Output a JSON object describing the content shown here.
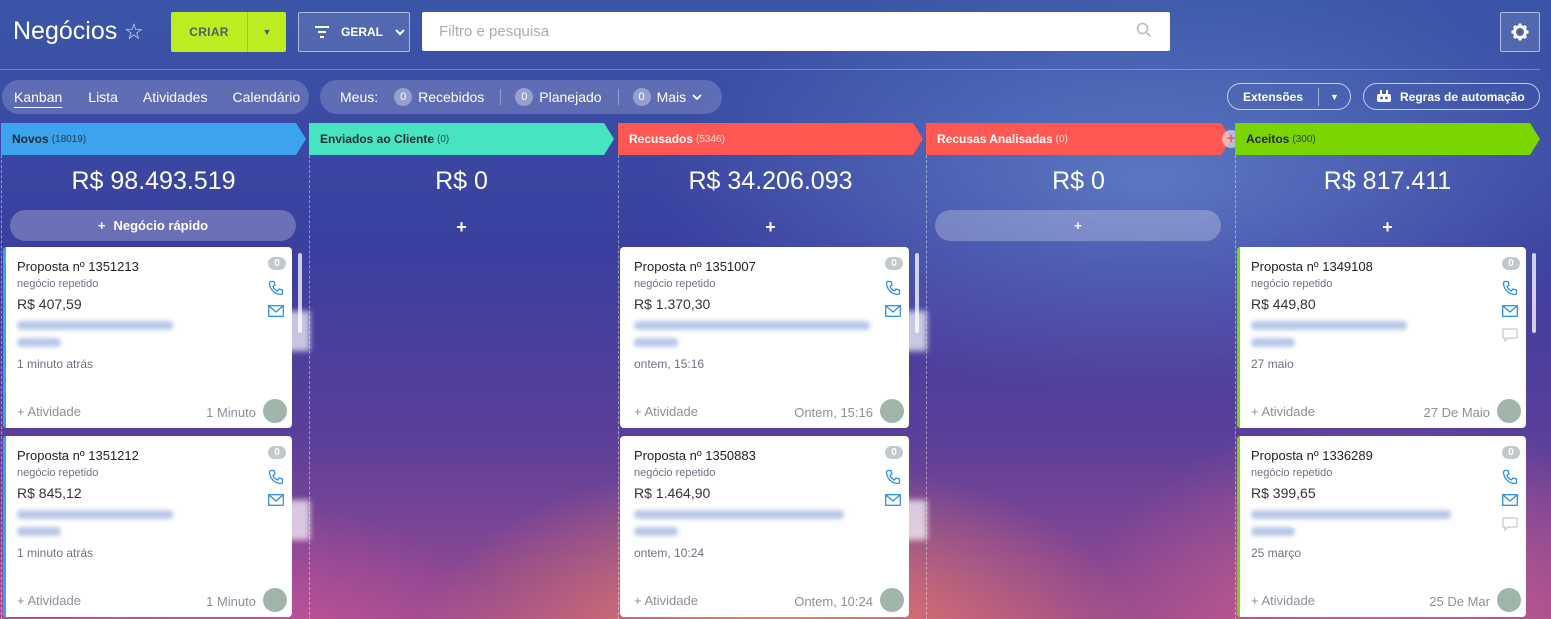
{
  "header": {
    "title": "Negócios",
    "create_label": "CRIAR",
    "filter_label": "GERAL",
    "search_placeholder": "Filtro e pesquisa"
  },
  "views": [
    "Kanban",
    "Lista",
    "Atividades",
    "Calendário"
  ],
  "counters": {
    "label": "Meus:",
    "items": [
      {
        "count": "0",
        "label": "Recebidos"
      },
      {
        "count": "0",
        "label": "Planejado"
      },
      {
        "count": "0",
        "label": "Mais"
      }
    ]
  },
  "toolbar": {
    "extensions_label": "Extensões",
    "automation_label": "Regras de automação"
  },
  "colors": {
    "create_button": "#bbed21",
    "stage_novos": "#3ea3ee",
    "stage_enviados": "#47e4c2",
    "stage_recusados": "#ff5752",
    "stage_analisadas": "#ff5752",
    "stage_aceitos": "#7bd500"
  },
  "columns": [
    {
      "name": "Novos",
      "count": "(18019)",
      "total": "R$ 98.493.519",
      "quick_add": "Negócio rápido",
      "cards": [
        {
          "name": "Proposta nº 1351213",
          "sub": "negócio repetido",
          "price": "R$ 407,59",
          "time": "1 minuto atrás",
          "activity": "+ Atividade",
          "date": "1 Minuto",
          "badge": "0"
        },
        {
          "name": "Proposta nº 1351212",
          "sub": "negócio repetido",
          "price": "R$ 845,12",
          "time": "1 minuto atrás",
          "activity": "+ Atividade",
          "date": "1 Minuto",
          "badge": "0"
        }
      ]
    },
    {
      "name": "Enviados ao Cliente",
      "count": "(0)",
      "total": "R$ 0",
      "quick_add": "+",
      "cards": []
    },
    {
      "name": "Recusados",
      "count": "(5346)",
      "total": "R$ 34.206.093",
      "quick_add": "+",
      "cards": [
        {
          "name": "Proposta nº 1351007",
          "sub": "negócio repetido",
          "price": "R$ 1.370,30",
          "time": "ontem, 15:16",
          "activity": "+ Atividade",
          "date": "Ontem, 15:16",
          "badge": "0"
        },
        {
          "name": "Proposta nº 1350883",
          "sub": "negócio repetido",
          "price": "R$ 1.464,90",
          "time": "ontem, 10:24",
          "activity": "+ Atividade",
          "date": "Ontem, 10:24",
          "badge": "0"
        }
      ]
    },
    {
      "name": "Recusas Analisadas",
      "count": "(0)",
      "total": "R$ 0",
      "quick_add": "+",
      "cards": []
    },
    {
      "name": "Aceitos",
      "count": "(300)",
      "total": "R$ 817.411",
      "quick_add": "+",
      "cards": [
        {
          "name": "Proposta nº 1349108",
          "sub": "negócio repetido",
          "price": "R$ 449,80",
          "time": "27 maio",
          "activity": "+ Atividade",
          "date": "27 De Maio",
          "badge": "0"
        },
        {
          "name": "Proposta nº 1336289",
          "sub": "negócio repetido",
          "price": "R$ 399,65",
          "time": "25 março",
          "activity": "+ Atividade",
          "date": "25 De Mar",
          "badge": "0"
        }
      ]
    }
  ]
}
